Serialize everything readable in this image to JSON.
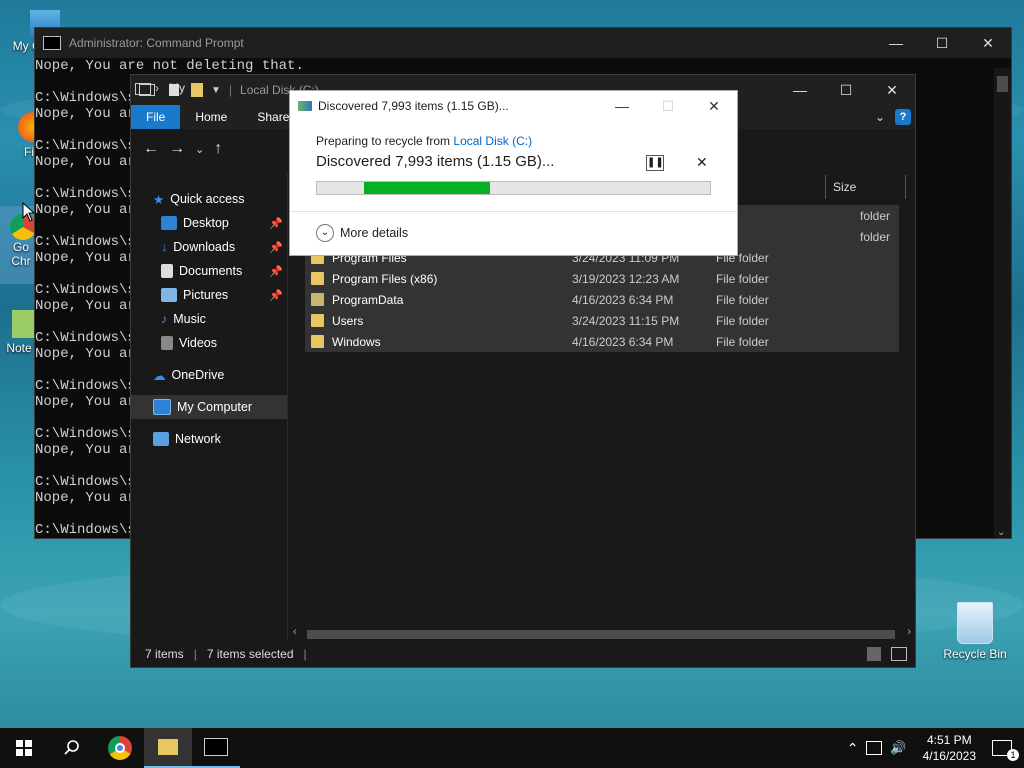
{
  "desktop": {
    "icons": [
      {
        "label": "My Co",
        "id": "my-computer"
      },
      {
        "label": "Fi",
        "id": "firefox"
      },
      {
        "label": "Go\nChr",
        "id": "chrome"
      },
      {
        "label": "Note",
        "id": "notepad"
      },
      {
        "label": "Recycle Bin",
        "id": "recycle"
      }
    ]
  },
  "cmd": {
    "title": "Administrator: Command Prompt",
    "lines": [
      "Nope, You are not deleting that.",
      "",
      "C:\\Windows\\s",
      "Nope, You ar",
      "",
      "C:\\Windows\\s",
      "Nope, You ar",
      "",
      "C:\\Windows\\s",
      "Nope, You ar",
      "",
      "C:\\Windows\\s",
      "Nope, You ar",
      "",
      "C:\\Windows\\s",
      "Nope, You ar",
      "",
      "C:\\Windows\\s",
      "Nope, You ar",
      "",
      "C:\\Windows\\s",
      "Nope, You ar",
      "",
      "C:\\Windows\\s",
      "Nope, You ar",
      "",
      "C:\\Windows\\s",
      "Nope, You ar",
      "",
      "C:\\Windows\\s"
    ]
  },
  "explorer": {
    "title": "Local Disk (C:)",
    "tabs": {
      "file": "File",
      "home": "Home",
      "share": "Share"
    },
    "address_partial": "My",
    "size_header": "Size",
    "nav": {
      "quick_access": "Quick access",
      "desktop": "Desktop",
      "downloads": "Downloads",
      "documents": "Documents",
      "pictures": "Pictures",
      "music": "Music",
      "videos": "Videos",
      "onedrive": "OneDrive",
      "my_computer": "My Computer",
      "network": "Network"
    },
    "rows": [
      {
        "name": "",
        "date": "",
        "type": "folder"
      },
      {
        "name": "",
        "date": "",
        "type": "folder"
      },
      {
        "name": "Program Files",
        "date": "3/24/2023 11:09 PM",
        "type": "File folder"
      },
      {
        "name": "Program Files (x86)",
        "date": "3/19/2023 12:23 AM",
        "type": "File folder"
      },
      {
        "name": "ProgramData",
        "date": "4/16/2023 6:34 PM",
        "type": "File folder"
      },
      {
        "name": "Users",
        "date": "3/24/2023 11:15 PM",
        "type": "File folder"
      },
      {
        "name": "Windows",
        "date": "4/16/2023 6:34 PM",
        "type": "File folder"
      }
    ],
    "status": {
      "items": "7 items",
      "selected": "7 items selected"
    }
  },
  "dialog": {
    "title": "Discovered 7,993 items (1.15 GB)...",
    "preparing_prefix": "Preparing to recycle from ",
    "preparing_link": "Local Disk (C:)",
    "heading": "Discovered 7,993 items (1.15 GB)...",
    "progress_fraction": 0.32,
    "more_details": "More details"
  },
  "taskbar": {
    "time": "4:51 PM",
    "date": "4/16/2023",
    "notification_count": "1"
  },
  "colors": {
    "accent": "#1979ca",
    "progress": "#06b025",
    "folder": "#e8c661"
  }
}
